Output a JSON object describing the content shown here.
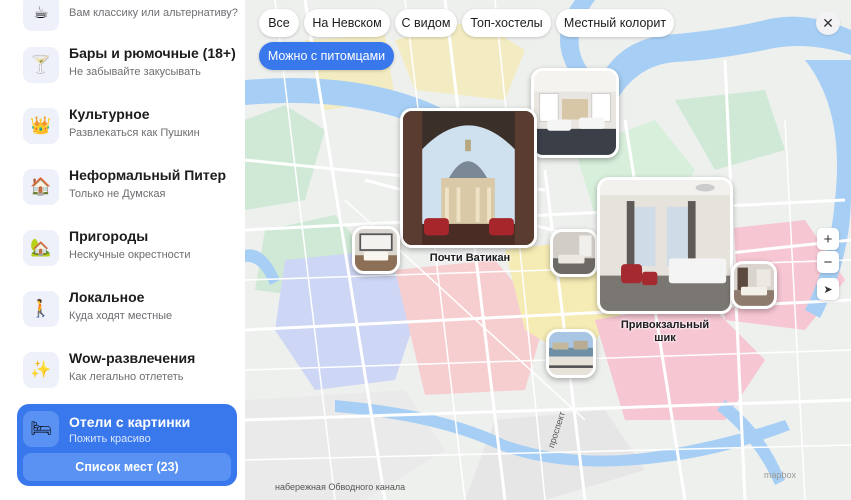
{
  "sidebar": {
    "categories": [
      {
        "title": "",
        "subtitle": "Вам классику или альтернативу?",
        "icon": "coffee-icon",
        "glyph": "☕"
      },
      {
        "title": "Бары и рюмочные (18+)",
        "subtitle": "Не забывайте закусывать",
        "icon": "cocktail-icon",
        "glyph": "🍸"
      },
      {
        "title": "Культурное",
        "subtitle": "Развлекаться как Пушкин",
        "icon": "crown-icon",
        "glyph": "👑"
      },
      {
        "title": "Неформальный Питер",
        "subtitle": "Только не Думская",
        "icon": "house-icon",
        "glyph": "🏠"
      },
      {
        "title": "Пригороды",
        "subtitle": "Нескучные окрестности",
        "icon": "tree-house-icon",
        "glyph": "🏡"
      },
      {
        "title": "Локальное",
        "subtitle": "Куда ходят местные",
        "icon": "walker-icon",
        "glyph": "🚶"
      },
      {
        "title": "Wow-развлечения",
        "subtitle": "Как легально отлететь",
        "icon": "sparkles-icon",
        "glyph": "✨"
      }
    ],
    "active": {
      "title": "Отели с картинки",
      "subtitle": "Пожить красиво",
      "icon": "bed-icon",
      "glyph": "🛏",
      "list_button": "Список мест (23)"
    }
  },
  "filters": [
    "Все",
    "На Невском",
    "С видом",
    "Топ-хостелы",
    "Местный колорит",
    "Можно с питомцами"
  ],
  "active_filter": "Можно с питомцами",
  "map": {
    "pins": [
      {
        "name": "pin-hotel-lobby",
        "label": ""
      },
      {
        "name": "pin-pochti-vatikan",
        "label": "Почти Ватикан"
      },
      {
        "name": "pin-hotel-small-1",
        "label": ""
      },
      {
        "name": "pin-hotel-small-2",
        "label": ""
      },
      {
        "name": "pin-privokzalny-shik",
        "label": "Привокзальный\nшик"
      },
      {
        "name": "pin-hotel-small-3",
        "label": ""
      },
      {
        "name": "pin-hotel-view",
        "label": ""
      }
    ],
    "street_labels": [
      "набережная Обводного канала",
      "проспект"
    ],
    "controls": {
      "zoom_in": "+",
      "zoom_out": "−",
      "locate": "➤",
      "close": "✕"
    },
    "attribution": "mapbox"
  },
  "colors": {
    "accent": "#3978ec",
    "water": "#a7cff5",
    "park": "#c4e8cf",
    "zone_red": "#f7c9cc",
    "zone_yellow": "#f6ebb1",
    "zone_blue": "#c9d3f2"
  }
}
